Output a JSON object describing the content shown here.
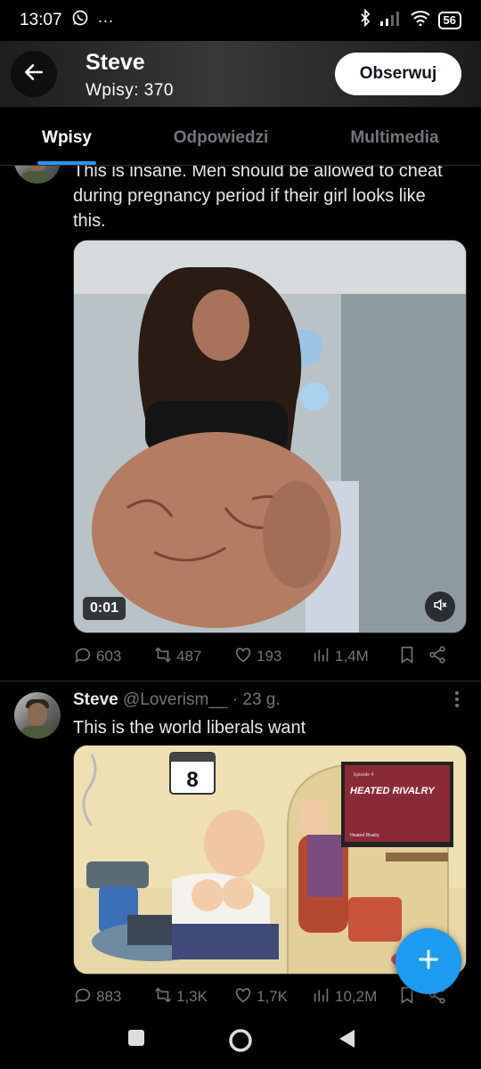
{
  "status_bar": {
    "time": "13:07",
    "battery": "56",
    "icons": [
      "whatsapp-icon",
      "more-dots-icon",
      "bluetooth-icon",
      "signal-icon",
      "wifi-icon",
      "battery-icon"
    ]
  },
  "header": {
    "name": "Steve",
    "post_count": "Wpisy: 370",
    "follow_label": "Obserwuj"
  },
  "tabs": [
    {
      "label": "Wpisy",
      "active": true
    },
    {
      "label": "Odpowiedzi",
      "active": false
    },
    {
      "label": "Multimedia",
      "active": false
    }
  ],
  "tweets": [
    {
      "text": "This is insane. Men should be allowed to cheat during pregnancy period if their girl looks like this.",
      "media": {
        "type": "video",
        "duration": "0:01"
      },
      "stats": {
        "replies": "603",
        "retweets": "487",
        "likes": "193",
        "views": "1,4M"
      }
    },
    {
      "name": "Steve",
      "handle": "@Loverism__",
      "time": "· 23 g.",
      "text": "This is the world liberals want",
      "media": {
        "type": "image",
        "calendar_number": "8",
        "tv_title": "HEATED RIVALRY",
        "tv_episode": "Episode 4",
        "tv_caption": "Heated Rivalry"
      },
      "stats": {
        "replies": "883",
        "retweets": "1,3K",
        "likes": "1,7K",
        "views": "10,2M"
      }
    }
  ],
  "colors": {
    "accent": "#1d9bf0",
    "muted": "#71767b",
    "background": "#000000"
  }
}
